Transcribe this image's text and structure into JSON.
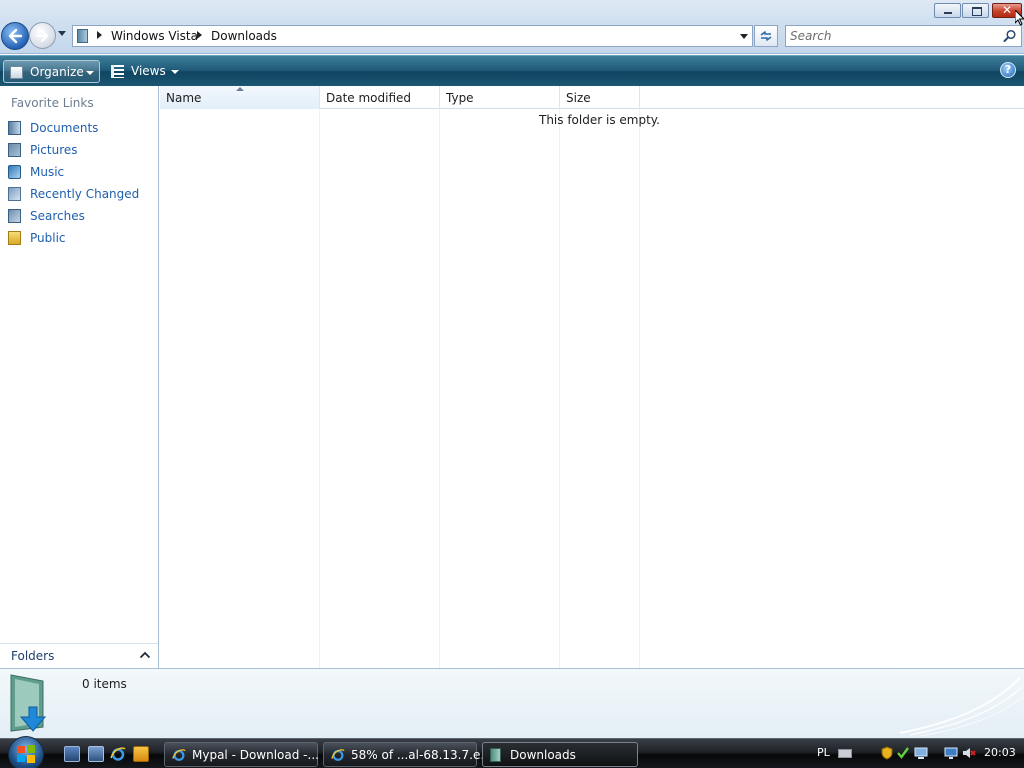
{
  "window": {
    "title_buttons": {
      "minimize": "minimize",
      "maximize": "maximize",
      "close": "close"
    }
  },
  "address": {
    "crumbs": [
      "Windows Vista",
      "Downloads"
    ]
  },
  "search": {
    "placeholder": "Search"
  },
  "commandbar": {
    "organize_label": "Organize",
    "views_label": "Views",
    "help_label": "?"
  },
  "navpane": {
    "favorite_links_title": "Favorite Links",
    "items": [
      {
        "label": "Documents",
        "icon": "documents-icon"
      },
      {
        "label": "Pictures",
        "icon": "pictures-icon"
      },
      {
        "label": "Music",
        "icon": "music-icon"
      },
      {
        "label": "Recently Changed",
        "icon": "recently-changed-icon"
      },
      {
        "label": "Searches",
        "icon": "searches-icon"
      },
      {
        "label": "Public",
        "icon": "public-folder-icon"
      }
    ],
    "folders_label": "Folders"
  },
  "filelist": {
    "columns": [
      "Name",
      "Date modified",
      "Type",
      "Size"
    ],
    "sorted_by": "Name",
    "empty_message": "This folder is empty."
  },
  "details": {
    "item_count": "0 items"
  },
  "taskbar": {
    "tasks": [
      {
        "label": "Mypal - Download -...",
        "icon": "ie-icon",
        "active": false
      },
      {
        "label": "58% of ...al-68.13.7.e...",
        "icon": "ie-icon",
        "active": false
      },
      {
        "label": "Downloads",
        "icon": "folder-icon",
        "active": true
      }
    ],
    "language": "PL",
    "clock": "20:03"
  },
  "colors": {
    "link_blue": "#1f5fae",
    "commandbar": "#1f5a78",
    "close_red": "#c9412a",
    "taskbar": "#1e2227"
  }
}
